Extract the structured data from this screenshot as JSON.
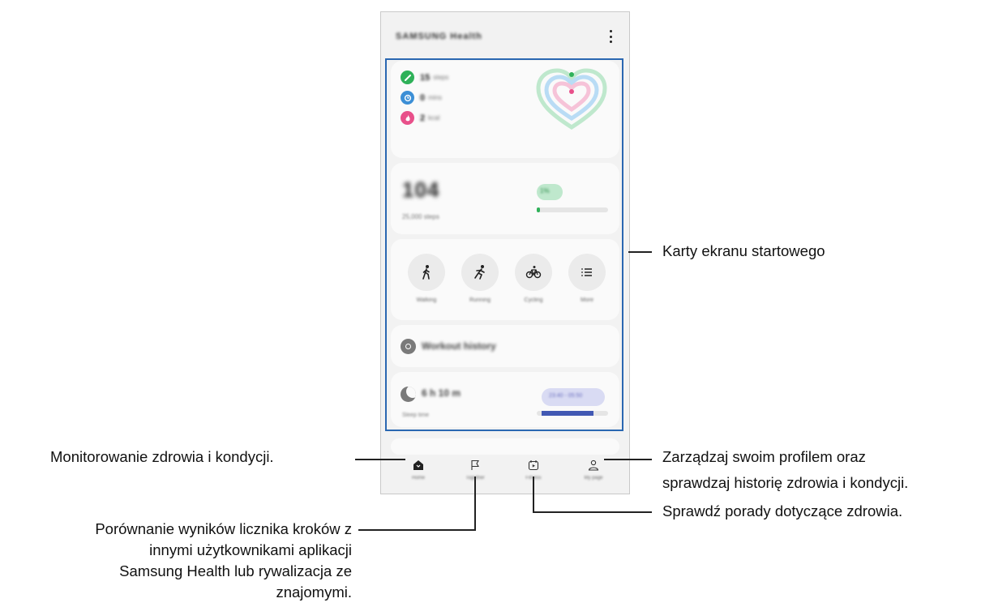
{
  "app": {
    "title": "SAMSUNG Health",
    "menu_icon": "more-vertical-icon"
  },
  "summary_card": {
    "metrics": [
      {
        "icon": "steps-icon",
        "color": "#2fb159",
        "value": "15",
        "unit": "steps"
      },
      {
        "icon": "clock-icon",
        "color": "#3c8fd6",
        "value": "0",
        "unit": "mins"
      },
      {
        "icon": "fire-icon",
        "color": "#e8508a",
        "value": "2",
        "unit": "kcal"
      }
    ],
    "visual": "heart-rings-icon"
  },
  "steps_card": {
    "value": "104",
    "target": "25,000 steps",
    "percent": "1%",
    "progress_fraction": 0.01
  },
  "activities_card": {
    "items": [
      {
        "icon": "walking-icon",
        "label": "Walking"
      },
      {
        "icon": "running-icon",
        "label": "Running"
      },
      {
        "icon": "cycling-icon",
        "label": "Cycling"
      },
      {
        "icon": "list-icon",
        "label": "More"
      }
    ]
  },
  "workout_card": {
    "title": "Workout history"
  },
  "sleep_card": {
    "value": "6 h 10 m",
    "label": "Sleep time",
    "range": "23:40 - 05:50"
  },
  "bottom_nav": [
    {
      "icon": "home-icon",
      "label": "Home"
    },
    {
      "icon": "flag-icon",
      "label": "Together"
    },
    {
      "icon": "fitness-icon",
      "label": "Fitness"
    },
    {
      "icon": "person-icon",
      "label": "My page"
    }
  ],
  "callouts": {
    "cards": "Karty ekranu startowego",
    "home": "Monitorowanie zdrowia i kondycji.",
    "profile_1": "Zarządzaj swoim profilem oraz",
    "profile_2": "sprawdzaj historię zdrowia i kondycji.",
    "together_1": "Porównanie wyników licznika kroków z",
    "together_2": "innymi użytkownikami aplikacji",
    "together_3": "Samsung Health lub rywalizacja ze",
    "together_4": "znajomymi.",
    "fitness": "Sprawdź porady dotyczące zdrowia."
  },
  "colors": {
    "highlight": "#2a67b1",
    "steps_green": "#2fb159",
    "sleep_blue": "#4158b3"
  }
}
